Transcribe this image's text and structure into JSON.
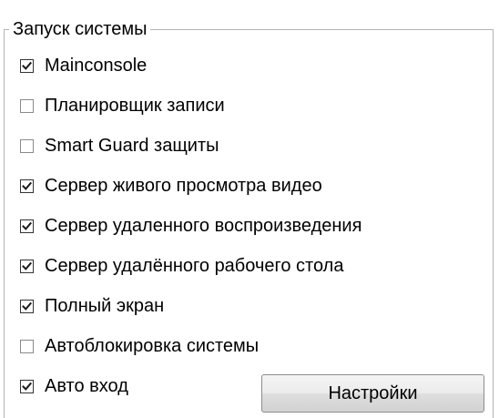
{
  "group": {
    "title": "Запуск системы"
  },
  "options": [
    {
      "label": "Mainconsole",
      "checked": true
    },
    {
      "label": "Планировщик записи",
      "checked": false
    },
    {
      "label": "Smart Guard защиты",
      "checked": false
    },
    {
      "label": "Сервер живого просмотра видео",
      "checked": true
    },
    {
      "label": "Сервер удаленного воспроизведения",
      "checked": true
    },
    {
      "label": "Сервер удалённого рабочего стола",
      "checked": true
    },
    {
      "label": "Полный экран",
      "checked": true
    },
    {
      "label": "Автоблокировка системы",
      "checked": false
    },
    {
      "label": "Авто вход",
      "checked": true
    }
  ],
  "buttons": {
    "settings_label": "Настройки"
  },
  "icons": {
    "check": "check-mark-icon"
  }
}
